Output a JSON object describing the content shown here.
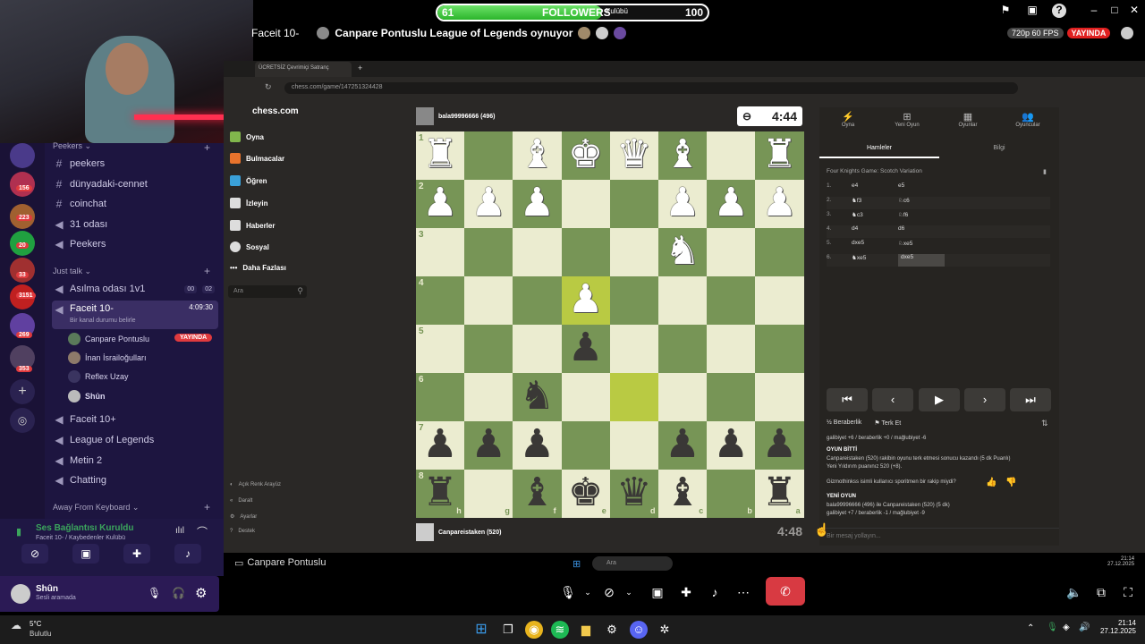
{
  "stream": {
    "follower_current": "61",
    "follower_label": "FOLLOWERS",
    "follower_sub": "Kulübü",
    "follower_goal": "100",
    "follower_progress": 0.61,
    "channel_name": "Faceit 10-",
    "stream_title": "Canpare Pontuslu League of Legends oynuyor",
    "quality": "720p 60 FPS",
    "live": "YAYINDA"
  },
  "discord": {
    "servers": [
      {
        "badge": "156"
      },
      {
        "badge": "223"
      },
      {
        "badge": "20"
      },
      {
        "badge": "33"
      },
      {
        "badge": "3151"
      },
      {
        "badge": "269"
      },
      {
        "badge": "353"
      }
    ],
    "categories": {
      "peekers": "Peekers",
      "just_talk": "Just talk",
      "away": "Away From Keyboard"
    },
    "text_channels": [
      "peekers",
      "dünyadaki-cennet",
      "coinchat"
    ],
    "voice_channels_top": [
      "31 odası",
      "Peekers"
    ],
    "asilma": {
      "name": "Asılma odası 1v1",
      "count_a": "00",
      "count_b": "02"
    },
    "faceit_active": {
      "name": "Faceit 10-",
      "timer": "4:09:30",
      "status": "Bir kanal durumu belirle"
    },
    "voice_users": [
      {
        "name": "Canpare Pontuslu",
        "live": "YAYINDA"
      },
      {
        "name": "İnan İsrailoğulları"
      },
      {
        "name": "Reflex Uzay"
      },
      {
        "name": "Shûn"
      }
    ],
    "voice_channels_bottom": [
      "Faceit 10+",
      "League of Legends",
      "Metin 2",
      "Chatting"
    ],
    "voice_connection": {
      "title": "Ses Bağlantısı Kuruldu",
      "subtitle": "Faceit 10- / Kaybedenler Kulübü"
    },
    "user": {
      "name": "Shûn",
      "status": "Sesli aramada"
    },
    "share_label": "Canpare Pontuslu"
  },
  "browser": {
    "tab_title": "ÜCRETSİZ Çevrimiçi Satranç",
    "url": "chess.com/game/147251324428"
  },
  "chess": {
    "logo": "chess.com",
    "nav": [
      "Oyna",
      "Bulmacalar",
      "Öğren",
      "İzleyin",
      "Haberler",
      "Sosyal",
      "Daha Fazlası"
    ],
    "search_placeholder": "Ara",
    "bottom_nav": [
      "Açık Renk Arayüz",
      "Daralt",
      "Ayarlar",
      "Destek"
    ],
    "top_player": {
      "name": "bala99996666 (496)",
      "clock": "4:44"
    },
    "bottom_player": {
      "name": "Canpareistaken (520)",
      "clock": "4:48"
    },
    "ranks": [
      "1",
      "2",
      "3",
      "4",
      "5",
      "6",
      "7",
      "8"
    ],
    "files": [
      "h",
      "g",
      "f",
      "e",
      "d",
      "c",
      "b",
      "a"
    ],
    "panel_tabs": [
      "Oyna",
      "Yeni Oyun",
      "Oyunlar",
      "Oyuncular"
    ],
    "sub_tabs": [
      "Hamleler",
      "Bilgi"
    ],
    "opening": "Four Knights Game: Scotch Variation",
    "moves": [
      {
        "n": "1.",
        "w": "e4",
        "b": "e5"
      },
      {
        "n": "2.",
        "w": "♞f3",
        "b": "♘c6"
      },
      {
        "n": "3.",
        "w": "♞c3",
        "b": "♘f6"
      },
      {
        "n": "4.",
        "w": "d4",
        "b": "d6"
      },
      {
        "n": "5.",
        "w": "dxe5",
        "b": "♘xe5"
      },
      {
        "n": "6.",
        "w": "♞xe5",
        "b": "dxe5"
      }
    ],
    "actions": {
      "draw": "Beraberlik",
      "resign": "Terk Et"
    },
    "chat": [
      "galibiyet +6 / beraberlik +0 / mağlubiyet -6",
      "OYUN BİTTİ",
      "Canpareistaken (520) rakibin oyunu terk etmesi sonucu kazandı (5 dk Puanlı)",
      "Yeni Yıldırım puanınız 520 (+8).",
      "Gizmothinkss isimli kullanıcı sporitmen bir rakip miydi?",
      "YENİ OYUN",
      "bala99996666 (496) ile Canpareistaken (520) (5 dk)",
      "galibiyet +7 / beraberlik -1 / mağlubiyet -9"
    ],
    "chat_placeholder": "Bir mesaj yollayın..."
  },
  "inner_taskbar": {
    "search": "Ara",
    "time": "21:14",
    "date": "27.12.2025"
  },
  "taskbar": {
    "weather_temp": "5°C",
    "weather_desc": "Bulutlu",
    "time": "21:14",
    "date": "27.12.2025"
  }
}
